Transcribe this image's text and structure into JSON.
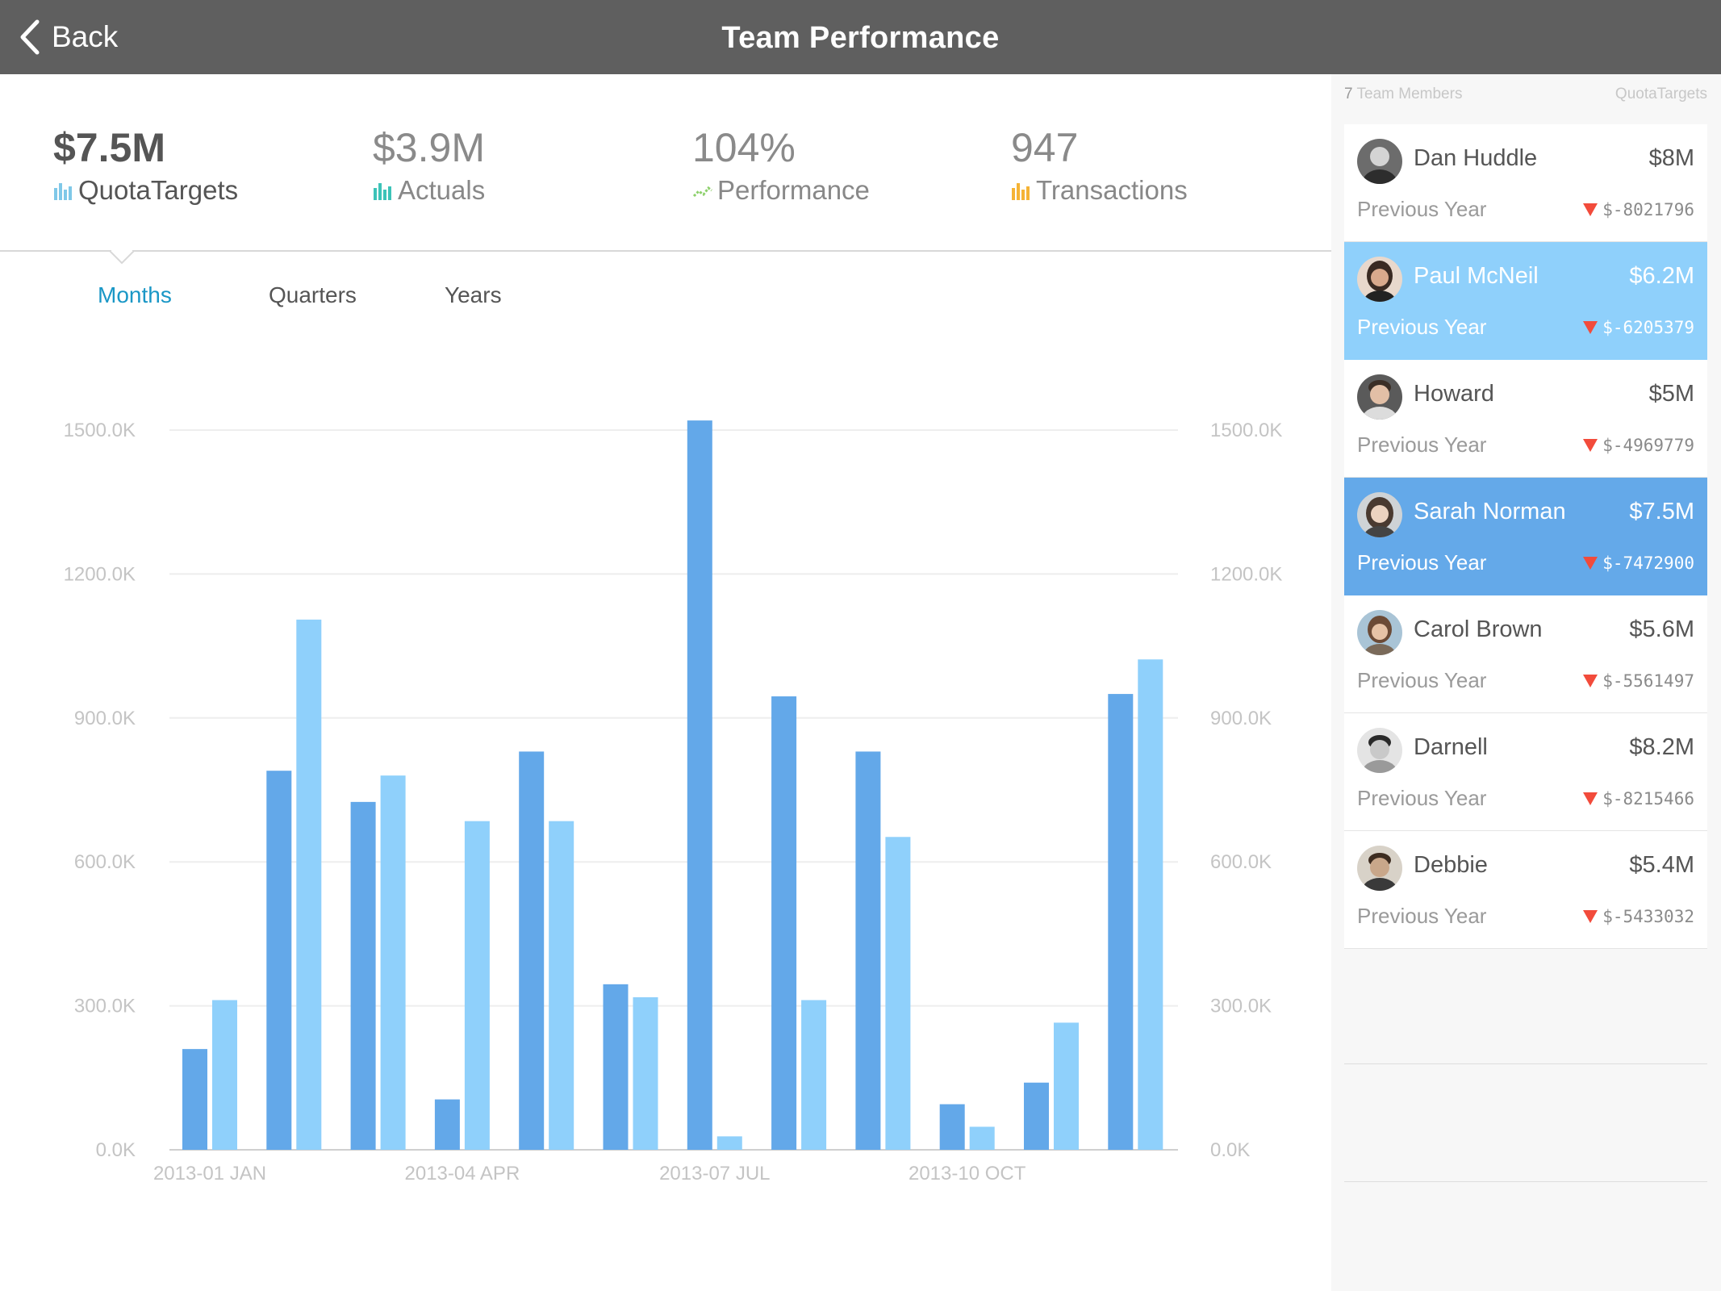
{
  "header": {
    "back_label": "Back",
    "title": "Team Performance"
  },
  "kpis": [
    {
      "value": "$7.5M",
      "label": "QuotaTargets",
      "icon": "bar-chart-icon",
      "color": "#7fc8e8"
    },
    {
      "value": "$3.9M",
      "label": "Actuals",
      "icon": "bar-chart-icon",
      "color": "#3cc3b8"
    },
    {
      "value": "104%",
      "label": "Performance",
      "icon": "line-chart-icon",
      "color": "#8cd06a"
    },
    {
      "value": "947",
      "label": "Transactions",
      "icon": "bar-chart-icon",
      "color": "#f5b335"
    }
  ],
  "tabs": [
    "Months",
    "Quarters",
    "Years"
  ],
  "chart_data": {
    "type": "bar",
    "categories": [
      "2013-01",
      "2013-02",
      "2013-03",
      "2013-04",
      "2013-05",
      "2013-06",
      "2013-07",
      "2013-08",
      "2013-09",
      "2013-10",
      "2013-11",
      "2013-12"
    ],
    "x_tick_labels": [
      "2013-01 JAN",
      "2013-04 APR",
      "2013-07 JUL",
      "2013-10 OCT"
    ],
    "y_tick_labels": [
      "1500.0K",
      "1200.0K",
      "900.0K",
      "600.0K",
      "300.0K",
      "0.0K"
    ],
    "ylim": [
      0,
      1500
    ],
    "grid": true,
    "series": [
      {
        "color": "#63a8e9",
        "values": [
          210,
          790,
          725,
          105,
          830,
          345,
          1520,
          945,
          830,
          95,
          140,
          950
        ]
      },
      {
        "color": "#8fd0fb",
        "values": [
          312,
          1105,
          780,
          685,
          685,
          318,
          28,
          312,
          652,
          48,
          265,
          1022
        ]
      }
    ]
  },
  "sidebar": {
    "count": "7",
    "count_label": "Team Members",
    "right_label": "QuotaTargets",
    "members": [
      {
        "name": "Dan Huddle",
        "amount": "$8M",
        "prev_label": "Previous Year",
        "delta": "$-8021796"
      },
      {
        "name": "Paul McNeil",
        "amount": "$6.2M",
        "prev_label": "Previous Year",
        "delta": "$-6205379"
      },
      {
        "name": "Howard",
        "amount": "$5M",
        "prev_label": "Previous Year",
        "delta": "$-4969779"
      },
      {
        "name": "Sarah Norman",
        "amount": "$7.5M",
        "prev_label": "Previous Year",
        "delta": "$-7472900"
      },
      {
        "name": "Carol Brown",
        "amount": "$5.6M",
        "prev_label": "Previous Year",
        "delta": "$-5561497"
      },
      {
        "name": "Darnell",
        "amount": "$8.2M",
        "prev_label": "Previous Year",
        "delta": "$-8215466"
      },
      {
        "name": "Debbie",
        "amount": "$5.4M",
        "prev_label": "Previous Year",
        "delta": "$-5433032"
      }
    ]
  }
}
